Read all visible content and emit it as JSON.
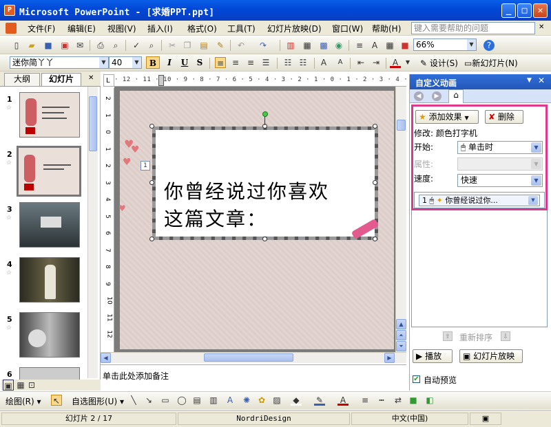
{
  "window": {
    "title": "Microsoft PowerPoint - [求婚PPT.ppt]",
    "app_icon": "P"
  },
  "menu": {
    "items": [
      "文件(F)",
      "编辑(E)",
      "视图(V)",
      "插入(I)",
      "格式(O)",
      "工具(T)",
      "幻灯片放映(D)",
      "窗口(W)",
      "帮助(H)"
    ],
    "help_placeholder": "键入需要帮助的问题"
  },
  "standard_toolbar": {
    "zoom": "66%"
  },
  "format_toolbar": {
    "font_name": "迷你简丫丫",
    "font_size": "40",
    "bold": "B",
    "italic": "I",
    "underline": "U",
    "shadow": "S",
    "design_label": "设计(S)",
    "new_slide_label": "新幻灯片(N)"
  },
  "left_panel": {
    "tabs": [
      "大纲",
      "幻灯片"
    ],
    "active_tab": "幻灯片",
    "slide_numbers": [
      "1",
      "2",
      "3",
      "4",
      "5",
      "6"
    ],
    "selected_slide": "2"
  },
  "slide": {
    "text_line1": "你曾经说过你喜欢",
    "text_line2": "这篇文章：",
    "animation_tag": "1"
  },
  "notes": {
    "placeholder": "单击此处添加备注"
  },
  "task_pane": {
    "title": "自定义动画",
    "add_effect_label": "添加效果",
    "remove_label": "删除",
    "modify_label": "修改: 颜色打字机",
    "start_label": "开始:",
    "start_value": "单击时",
    "property_label": "属性:",
    "speed_label": "速度:",
    "speed_value": "快速",
    "anim_item_number": "1",
    "anim_item_text": "你曾经说过你...",
    "reorder_label": "重新排序",
    "play_label": "播放",
    "slideshow_label": "幻灯片放映",
    "autopreview_label": "自动预览",
    "autopreview_checked": true
  },
  "drawing_toolbar": {
    "draw_label": "绘图(R)",
    "autoshape_label": "自选图形(U)"
  },
  "status_bar": {
    "slide_indicator": "幻灯片 2 / 17",
    "design": "NordriDesign",
    "language": "中文(中国)"
  },
  "colors": {
    "highlight_border": "#e0378a",
    "title_bar": "#0047d6",
    "taskpane_header": "#2456b8"
  }
}
